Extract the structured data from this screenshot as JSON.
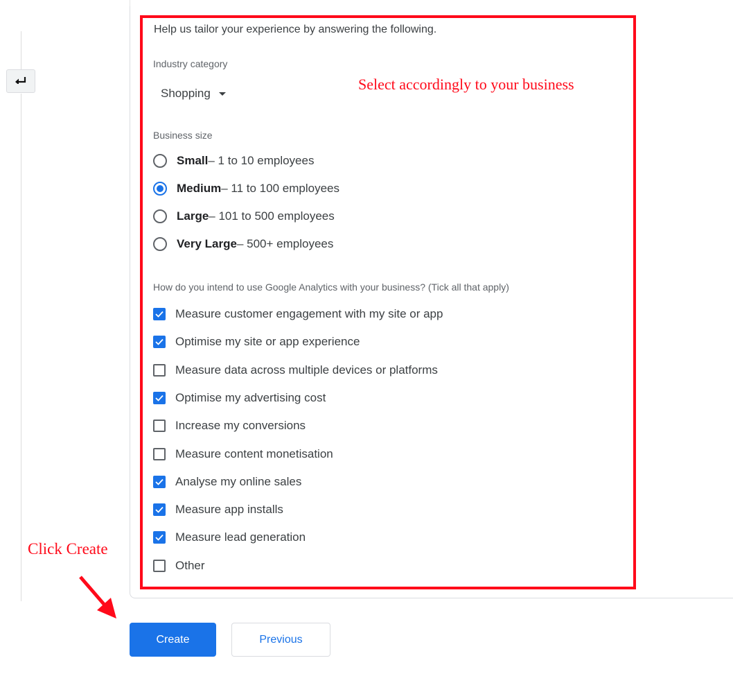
{
  "form": {
    "intro": "Help us tailor your experience by answering the following.",
    "industry": {
      "label": "Industry category",
      "selected": "Shopping"
    },
    "business_size": {
      "label": "Business size",
      "options": [
        {
          "name": "Small",
          "detail": " – 1 to 10 employees",
          "selected": false
        },
        {
          "name": "Medium",
          "detail": " – 11 to 100 employees",
          "selected": true
        },
        {
          "name": "Large",
          "detail": " – 101 to 500 employees",
          "selected": false
        },
        {
          "name": "Very Large",
          "detail": " – 500+ employees",
          "selected": false
        }
      ]
    },
    "usage": {
      "label": "How do you intend to use Google Analytics with your business? (Tick all that apply)",
      "options": [
        {
          "label": "Measure customer engagement with my site or app",
          "checked": true
        },
        {
          "label": "Optimise my site or app experience",
          "checked": true
        },
        {
          "label": "Measure data across multiple devices or platforms",
          "checked": false
        },
        {
          "label": "Optimise my advertising cost",
          "checked": true
        },
        {
          "label": "Increase my conversions",
          "checked": false
        },
        {
          "label": "Measure content monetisation",
          "checked": false
        },
        {
          "label": "Analyse my online sales",
          "checked": true
        },
        {
          "label": "Measure app installs",
          "checked": true
        },
        {
          "label": "Measure lead generation",
          "checked": true
        },
        {
          "label": "Other",
          "checked": false
        }
      ]
    }
  },
  "buttons": {
    "create": "Create",
    "previous": "Previous"
  },
  "annotations": {
    "select_note": "Select accordingly to your business",
    "click_note": "Click Create",
    "color": "#ff0a1a"
  },
  "colors": {
    "accent": "#1a73e8"
  },
  "icons": {
    "back": "return-arrow-icon",
    "dropdown": "caret-down-icon",
    "check": "checkmark-icon",
    "pointer": "red-arrow-icon"
  }
}
